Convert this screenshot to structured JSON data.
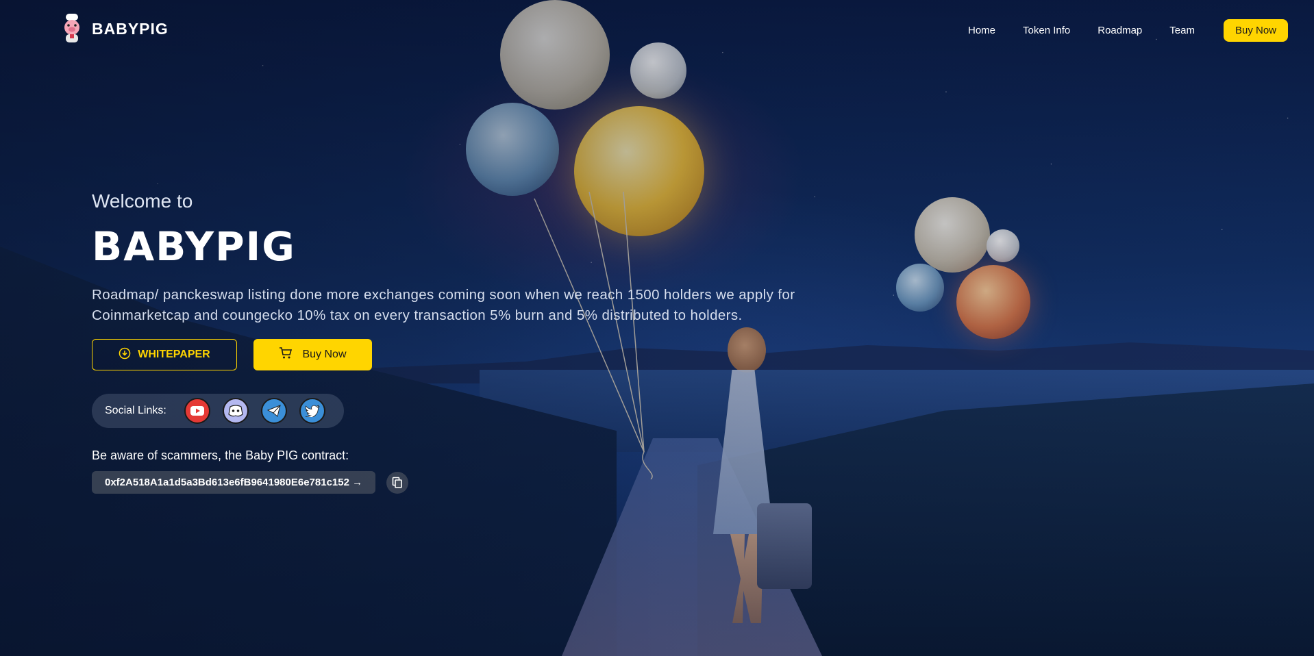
{
  "header": {
    "brand": "BABYPIG",
    "nav": [
      {
        "label": "Home"
      },
      {
        "label": "Token Info"
      },
      {
        "label": "Roadmap"
      },
      {
        "label": "Team"
      }
    ],
    "buy_label": "Buy Now"
  },
  "hero": {
    "welcome": "Welcome to",
    "title": "BABYPIG",
    "description": "Roadmap/ panckeswap listing done more exchanges coming soon when we reach 1500 holders we apply for Coinmarketcap and coungecko 10% tax on every transaction 5% burn and 5% distributed to holders.",
    "whitepaper_label": "WHITEPAPER",
    "buy_label": "Buy Now",
    "social_label": "Social Links:",
    "social_icons": [
      "youtube-icon",
      "discord-icon",
      "telegram-icon",
      "twitter-icon"
    ],
    "warning": "Be aware of scammers, the Baby PIG contract:",
    "contract": "0xf2A518A1a1d5a3Bd613e6fB9641980E6e781c152 →"
  },
  "colors": {
    "accent": "#ffd500",
    "background": "#0b1a3a"
  }
}
